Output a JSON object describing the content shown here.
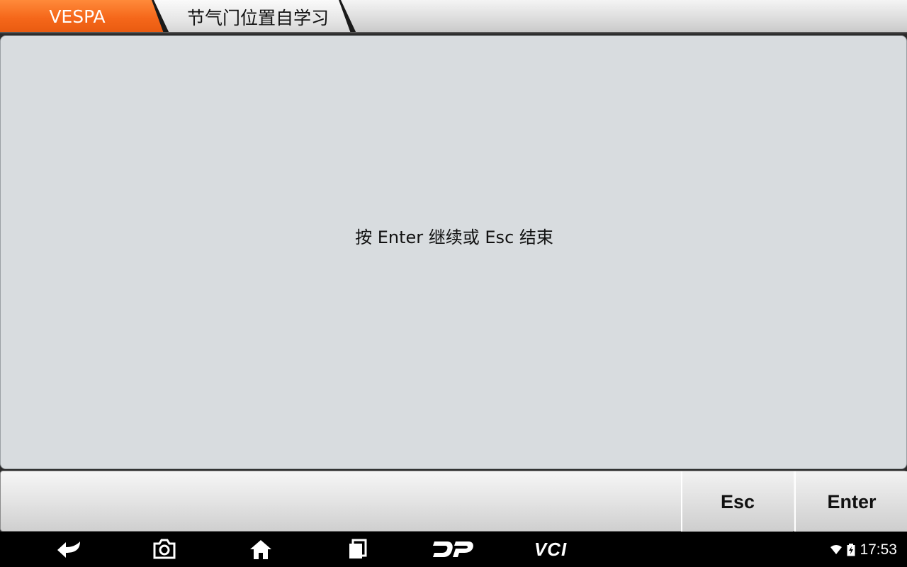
{
  "header": {
    "brand_label": "VESPA",
    "page_title": "节气门位置自学习"
  },
  "main": {
    "message": "按 Enter 继续或 Esc 结束"
  },
  "actions": {
    "esc_label": "Esc",
    "enter_label": "Enter"
  },
  "navbar": {
    "icons": [
      "back-icon",
      "camera-icon",
      "home-icon",
      "recent-apps-icon",
      "dp-logo-icon",
      "vci-icon"
    ],
    "vci_label": "VCI"
  },
  "status": {
    "time": "17:53"
  },
  "colors": {
    "brand_orange": "#f5671a",
    "panel_bg": "#d8dcdf",
    "navbar_bg": "#000000"
  }
}
